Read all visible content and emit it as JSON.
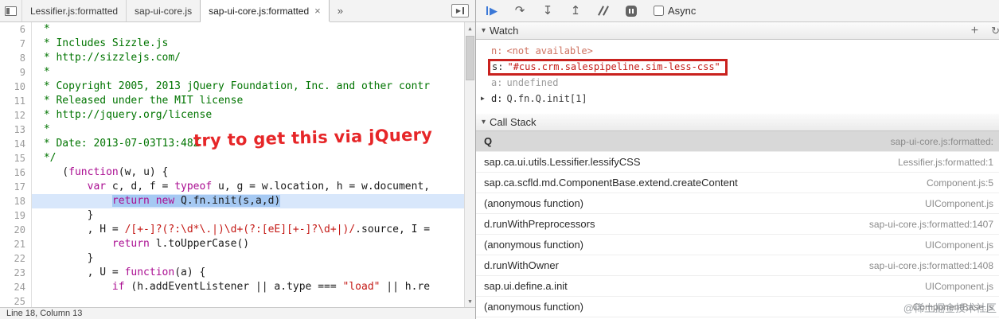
{
  "colors": {
    "annotation_red": "#e62628",
    "red_box": "#c9211e",
    "exec_line_blue": "#d8e7fb",
    "selection_blue": "#a5c9f3",
    "resume_blue": "#3b78d7",
    "string_red": "#c41a16",
    "keyword_purple": "#aa0d91",
    "comment_green": "#007400",
    "selected_frame_gray": "#d8d8d8"
  },
  "tabbar": {
    "tabs": [
      {
        "label": "Lessifier.js:formatted",
        "active": false
      },
      {
        "label": "sap-ui-core.js",
        "active": false
      },
      {
        "label": "sap-ui-core.js:formatted",
        "active": true
      }
    ],
    "overflow_label": "»",
    "close_label": "×"
  },
  "editor": {
    "annotation": "try to get this via jQuery",
    "status": "Line 18, Column 13",
    "lines": [
      {
        "num": 6,
        "tokens": [
          {
            "t": " *",
            "c": "com"
          }
        ]
      },
      {
        "num": 7,
        "tokens": [
          {
            "t": " * Includes Sizzle.js",
            "c": "com"
          }
        ]
      },
      {
        "num": 8,
        "tokens": [
          {
            "t": " * http://sizzlejs.com/",
            "c": "com"
          }
        ]
      },
      {
        "num": 9,
        "tokens": [
          {
            "t": " *",
            "c": "com"
          }
        ]
      },
      {
        "num": 10,
        "tokens": [
          {
            "t": " * Copyright 2005, 2013 jQuery Foundation, Inc. and other contr",
            "c": "com"
          }
        ]
      },
      {
        "num": 11,
        "tokens": [
          {
            "t": " * Released under the MIT license",
            "c": "com"
          }
        ]
      },
      {
        "num": 12,
        "tokens": [
          {
            "t": " * http://jquery.org/license",
            "c": "com"
          }
        ]
      },
      {
        "num": 13,
        "tokens": [
          {
            "t": " *",
            "c": "com"
          }
        ]
      },
      {
        "num": 14,
        "tokens": [
          {
            "t": " * Date: 2013-07-03T13:48Z",
            "c": "com"
          }
        ]
      },
      {
        "num": 15,
        "tokens": [
          {
            "t": " */",
            "c": "com"
          }
        ]
      },
      {
        "num": 16,
        "tokens": [
          {
            "t": "    (",
            "c": "pln"
          },
          {
            "t": "function",
            "c": "kwd"
          },
          {
            "t": "(w, u) {",
            "c": "pln"
          }
        ]
      },
      {
        "num": 17,
        "tokens": [
          {
            "t": "        ",
            "c": "pln"
          },
          {
            "t": "var",
            "c": "kwd"
          },
          {
            "t": " c, d, f = ",
            "c": "pln"
          },
          {
            "t": "typeof",
            "c": "kwd"
          },
          {
            "t": " u, g = w.location, h = w.document,",
            "c": "pln"
          }
        ]
      },
      {
        "num": 18,
        "exec": true,
        "tokens": [
          {
            "t": "            ",
            "c": "pln"
          },
          {
            "t": "return",
            "c": "kwd",
            "sel": true
          },
          {
            "t": " ",
            "c": "pln",
            "sel": true
          },
          {
            "t": "new",
            "c": "kwd",
            "sel": true
          },
          {
            "t": " Q.fn.init(s,a,d)",
            "c": "pln",
            "sel": true
          }
        ]
      },
      {
        "num": 19,
        "tokens": [
          {
            "t": "        }",
            "c": "pln"
          }
        ]
      },
      {
        "num": 20,
        "tokens": [
          {
            "t": "        , H = ",
            "c": "pln"
          },
          {
            "t": "/[+-]?(?:\\d*\\.|)\\d+(?:[eE][+-]?\\d+|)/",
            "c": "str"
          },
          {
            "t": ".source, I = ",
            "c": "pln"
          }
        ]
      },
      {
        "num": 21,
        "tokens": [
          {
            "t": "            ",
            "c": "pln"
          },
          {
            "t": "return",
            "c": "kwd"
          },
          {
            "t": " l.toUpperCase()",
            "c": "pln"
          }
        ]
      },
      {
        "num": 22,
        "tokens": [
          {
            "t": "        }",
            "c": "pln"
          }
        ]
      },
      {
        "num": 23,
        "tokens": [
          {
            "t": "        , U = ",
            "c": "pln"
          },
          {
            "t": "function",
            "c": "kwd"
          },
          {
            "t": "(a) {",
            "c": "pln"
          }
        ]
      },
      {
        "num": 24,
        "tokens": [
          {
            "t": "            ",
            "c": "pln"
          },
          {
            "t": "if",
            "c": "kwd"
          },
          {
            "t": " (h.addEventListener || a.type === ",
            "c": "pln"
          },
          {
            "t": "\"load\"",
            "c": "str"
          },
          {
            "t": " || h.re",
            "c": "pln"
          }
        ]
      },
      {
        "num": 25,
        "tokens": []
      }
    ]
  },
  "debug_toolbar": {
    "async_label": "Async",
    "async_checked": false,
    "icons": {
      "resume": "▶",
      "step_over": "↷",
      "step_into": "↧",
      "step_out": "↥"
    }
  },
  "watch": {
    "title": "Watch",
    "add_icon": "+",
    "refresh_icon": "↻",
    "collapse_icon": "▾",
    "expand_icon": "▶",
    "items": [
      {
        "name": "n:",
        "value": "<not available>",
        "kind": "na"
      },
      {
        "name": "s:",
        "value": "\"#cus.crm.salespipeline.sim-less-css\"",
        "kind": "str",
        "boxed": true
      },
      {
        "name": "a:",
        "value": "undefined",
        "kind": "undef"
      },
      {
        "name": "d:",
        "value": "Q.fn.Q.init[1]",
        "kind": "obj",
        "expandable": true
      }
    ]
  },
  "callstack": {
    "title": "Call Stack",
    "collapse_icon": "▾",
    "frames": [
      {
        "fn": "Q",
        "loc": "sap-ui-core.js:formatted:",
        "selected": true
      },
      {
        "fn": "sap.ca.ui.utils.Lessifier.lessifyCSS",
        "loc": "Lessifier.js:formatted:1"
      },
      {
        "fn": "sap.ca.scfld.md.ComponentBase.extend.createContent",
        "loc": "Component.js:5"
      },
      {
        "fn": "(anonymous function)",
        "loc": "UIComponent.js"
      },
      {
        "fn": "d.runWithPreprocessors",
        "loc": "sap-ui-core.js:formatted:1407"
      },
      {
        "fn": "(anonymous function)",
        "loc": "UIComponent.js"
      },
      {
        "fn": "d.runWithOwner",
        "loc": "sap-ui-core.js:formatted:1408"
      },
      {
        "fn": "sap.ui.define.a.init",
        "loc": "UIComponent.js"
      },
      {
        "fn": "(anonymous function)",
        "loc": "ComponentBase.js"
      }
    ]
  },
  "scrollbar": {
    "up_icon": "▲",
    "down_icon": "▼"
  },
  "watermark": "@稀土掘金技术社区"
}
